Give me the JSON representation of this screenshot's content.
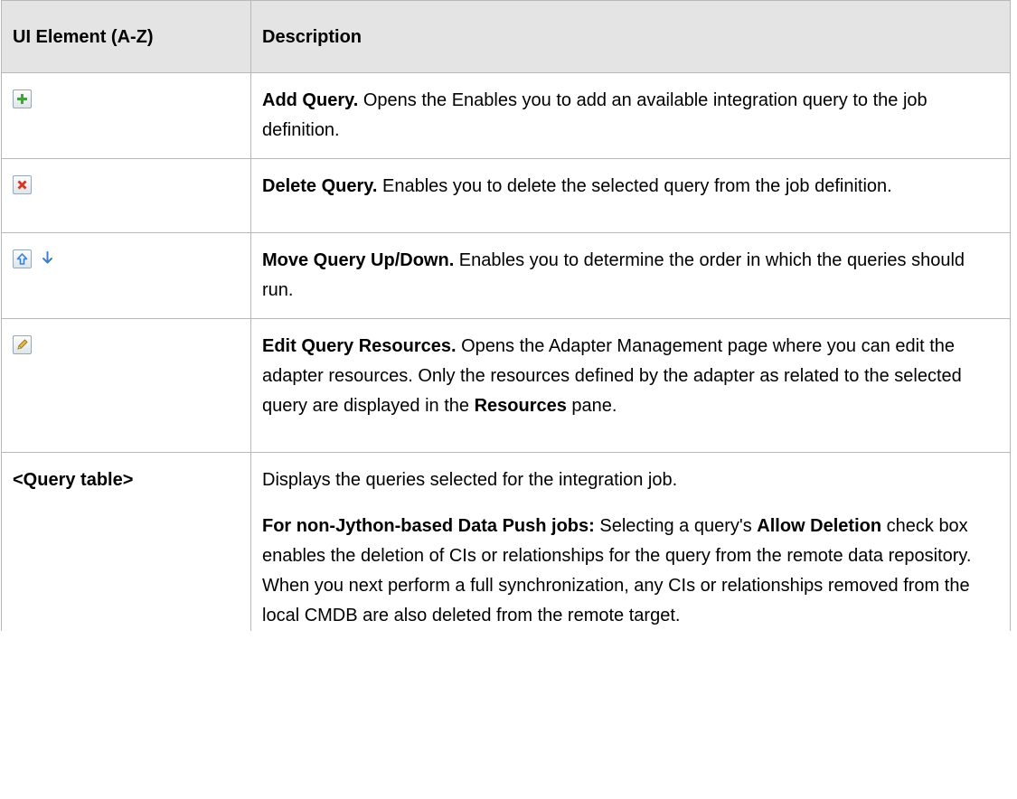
{
  "table": {
    "headers": {
      "element": "UI Element (A-Z)",
      "description": "Description"
    },
    "rows": [
      {
        "icons": [
          "add-query-icon"
        ],
        "title": "Add Query.",
        "text": " Opens the Enables you to add an available integration query to the job definition."
      },
      {
        "icons": [
          "delete-query-icon"
        ],
        "title": "Delete Query.",
        "text": " Enables you to delete the selected query from the job definition."
      },
      {
        "icons": [
          "move-up-icon",
          "move-down-icon"
        ],
        "title": "Move Query Up/Down.",
        "text": " Enables you to determine the order in which the queries should run."
      },
      {
        "icons": [
          "edit-icon"
        ],
        "title": "Edit Query Resources.",
        "text_before": " Opens the Adapter Management page where you can edit the adapter resources. Only the resources defined by the adapter as related to the selected query are displayed in the ",
        "bold_term": "Resources",
        "text_after": " pane."
      },
      {
        "element_label": "<Query table>",
        "p1": "Displays the queries selected for the integration job.",
        "p2_lead": "For non-Jython-based Data Push jobs:",
        "p2_text1": " Selecting a query's ",
        "p2_bold": "Allow Deletion",
        "p2_text2": " check box enables the deletion of CIs or relationships for the query from the remote data repository. When you next perform a full synchronization, any CIs or relationships removed from the local CMDB are also deleted from the remote target."
      }
    ]
  },
  "colors": {
    "header_bg": "#e4e4e4",
    "border": "#b8b8b8",
    "add_icon": "#3fa53a",
    "delete_icon": "#d9341f",
    "arrow_icon": "#3b7fd1",
    "pencil_icon": "#e7b93c"
  }
}
